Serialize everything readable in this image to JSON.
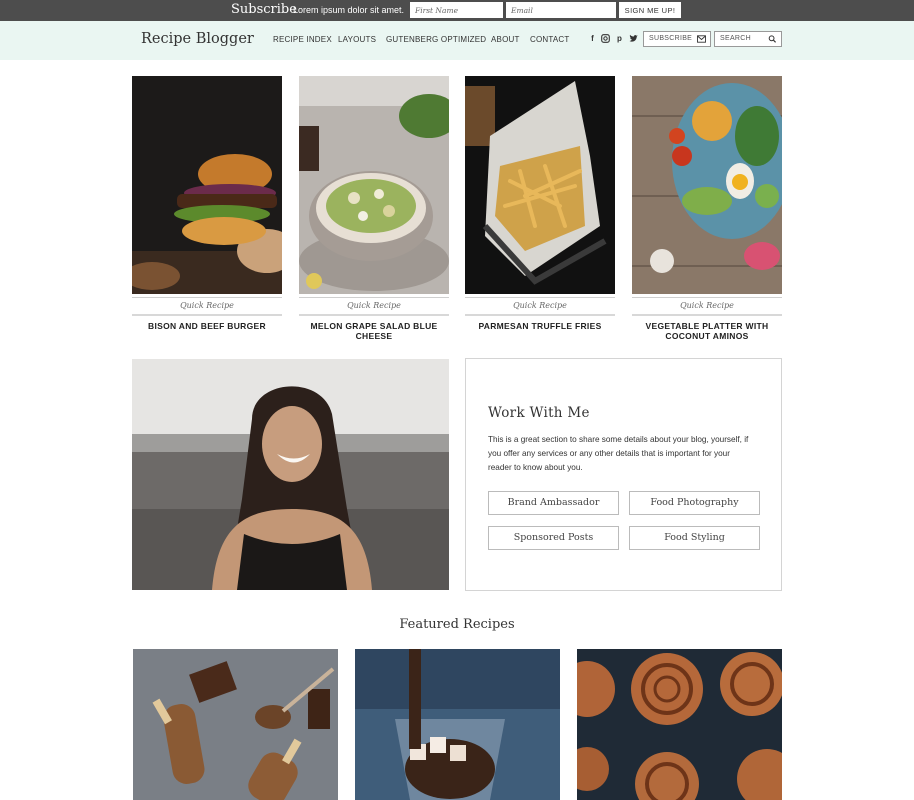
{
  "subscribe": {
    "title": "Subscribe",
    "text": "Lorem ipsum dolor sit amet.",
    "first_name_placeholder": "First Name",
    "email_placeholder": "Email",
    "button": "SIGN ME UP!"
  },
  "header": {
    "logo": "Recipe Blogger",
    "nav": [
      "RECIPE INDEX",
      "LAYOUTS",
      "GUTENBERG OPTIMIZED",
      "ABOUT",
      "CONTACT"
    ],
    "social_icons": [
      "facebook-icon",
      "instagram-icon",
      "pinterest-icon",
      "twitter-icon"
    ],
    "subscribe_label": "SUBSCRIBE",
    "search_label": "SEARCH"
  },
  "recipes": [
    {
      "category": "Quick Recipe",
      "title": "BISON AND BEEF BURGER"
    },
    {
      "category": "Quick Recipe",
      "title": "MELON GRAPE SALAD BLUE CHEESE"
    },
    {
      "category": "Quick Recipe",
      "title": "PARMESAN TRUFFLE FRIES"
    },
    {
      "category": "Quick Recipe",
      "title": "VEGETABLE PLATTER WITH COCONUT AMINOS"
    }
  ],
  "work": {
    "title": "Work With Me",
    "description": "This is a great section to share some details about your blog, yourself, if you offer any services or any other details that is important for your reader to know about you.",
    "buttons": [
      "Brand Ambassador",
      "Food Photography",
      "Sponsored Posts",
      "Food Styling"
    ]
  },
  "featured": {
    "title": "Featured Recipes"
  },
  "colors": {
    "subscribe_bar": "#4d4d4d",
    "header_bg": "#eaf6f2"
  }
}
